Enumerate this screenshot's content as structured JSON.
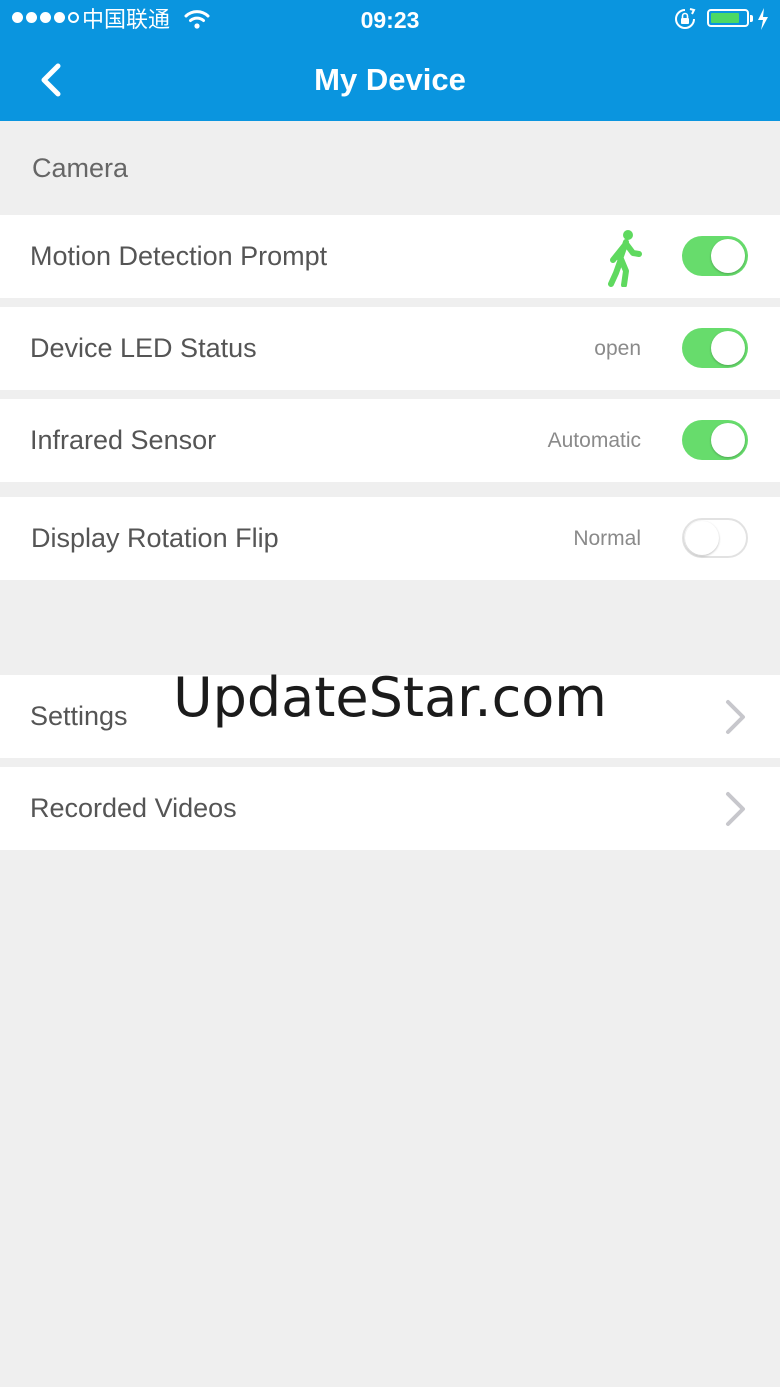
{
  "status_bar": {
    "carrier": "中国联通",
    "time": "09:23",
    "battery_level": 0.85
  },
  "nav": {
    "title": "My Device"
  },
  "camera_section": {
    "label": "Camera",
    "rows": [
      {
        "label": "Motion Detection Prompt",
        "value": "",
        "toggle": true
      },
      {
        "label": "Device LED Status",
        "value": "open",
        "toggle": true
      },
      {
        "label": "Infrared Sensor",
        "value": "Automatic",
        "toggle": true
      },
      {
        "label": "Display Rotation Flip",
        "value": "Normal",
        "toggle": false
      }
    ]
  },
  "links": [
    {
      "label": "Settings"
    },
    {
      "label": "Recorded Videos"
    }
  ],
  "watermark": "UpdateStar.com",
  "colors": {
    "nav_bar": "#0a95df",
    "toggle_on": "#67dc6c",
    "background": "#efefef"
  }
}
